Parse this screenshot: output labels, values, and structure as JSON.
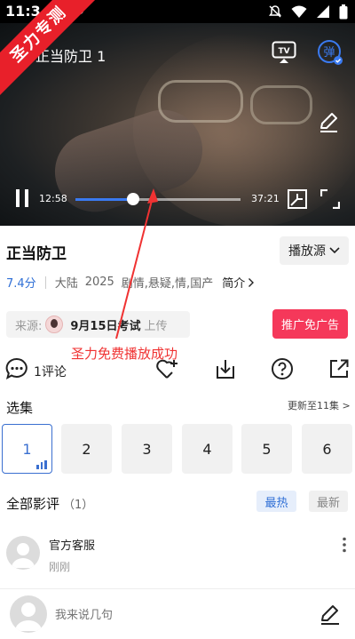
{
  "status_bar": {
    "time": "11:3"
  },
  "banner": {
    "text": "圣力专测"
  },
  "player": {
    "title": "正当防卫 1",
    "current_time": "12:58",
    "total_time": "37:21",
    "progress": 0.347,
    "danmu_label": "弹",
    "tv_label": "TV"
  },
  "info": {
    "title": "正当防卫",
    "source_button": "播放源",
    "score": "7.4分",
    "region": "大陆",
    "year": "2025",
    "genres": "剧情,悬疑,情,国产",
    "intro": "简介",
    "from_label": "来源:",
    "uploader": "9月15日考试",
    "upload_text": "上传",
    "promo_button": "推广免广告"
  },
  "overlay_text": "圣力免费播放成功",
  "actions": {
    "comment_count": "1评论"
  },
  "episodes": {
    "heading": "选集",
    "update_note": "更新至11集 >",
    "items": [
      "1",
      "2",
      "3",
      "4",
      "5",
      "6"
    ]
  },
  "reviews": {
    "heading": "全部影评",
    "count": "（1）",
    "sort_hot": "最热",
    "sort_new": "最新",
    "items": [
      {
        "name": "官方客服",
        "time": "刚刚"
      }
    ]
  },
  "composer": {
    "placeholder": "我来说几句"
  },
  "colors": {
    "accent": "#3a6fd0",
    "promo": "#f5385a",
    "banner": "#e8202a",
    "overlay": "#f03232"
  }
}
